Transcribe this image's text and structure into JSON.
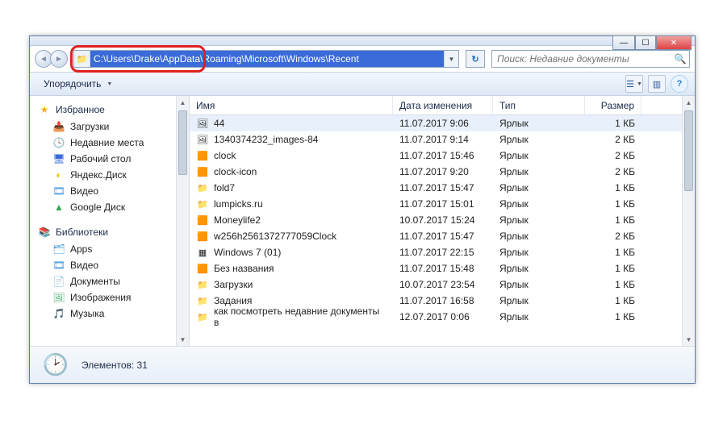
{
  "titlebar": {
    "min": "—",
    "max": "☐",
    "close": "✕"
  },
  "nav": {
    "address": "C:\\Users\\Drake\\AppData\\Roaming\\Microsoft\\Windows\\Recent",
    "search_placeholder": "Поиск: Недавние документы",
    "refresh": "↻",
    "back": "◄",
    "fwd": "►",
    "dd": "▼"
  },
  "toolbar": {
    "organize": "Упорядочить",
    "view": "☰",
    "pane": "▥",
    "help": "?"
  },
  "sidebar": {
    "fav": {
      "label": "Избранное",
      "items": [
        {
          "icon": "folder-dl",
          "label": "Загрузки",
          "color": "#f5b955"
        },
        {
          "icon": "recent",
          "label": "Недавние места",
          "color": "#7a8ea8"
        },
        {
          "icon": "desktop",
          "label": "Рабочий стол",
          "color": "#3a6bd8"
        },
        {
          "icon": "yadisk",
          "label": "Яндекс.Диск",
          "color": "#f0c400"
        },
        {
          "icon": "video",
          "label": "Видео",
          "color": "#3a8fd8"
        },
        {
          "icon": "gdrive",
          "label": "Google Диск",
          "color": "#34a853"
        }
      ]
    },
    "lib": {
      "label": "Библиотеки",
      "items": [
        {
          "icon": "apps",
          "label": "Apps",
          "color": "#4aa0e0"
        },
        {
          "icon": "video",
          "label": "Видео",
          "color": "#3a8fd8"
        },
        {
          "icon": "docs",
          "label": "Документы",
          "color": "#d8a050"
        },
        {
          "icon": "images",
          "label": "Изображения",
          "color": "#50b070"
        },
        {
          "icon": "music",
          "label": "Музыка",
          "color": "#d88030"
        }
      ]
    }
  },
  "columns": {
    "name": "Имя",
    "date": "Дата изменения",
    "type": "Тип",
    "size": "Размер"
  },
  "rows": [
    {
      "icon": "img",
      "name": "44",
      "date": "11.07.2017 9:06",
      "type": "Ярлык",
      "size": "1 КБ",
      "sel": true
    },
    {
      "icon": "img",
      "name": "1340374232_images-84",
      "date": "11.07.2017 9:14",
      "type": "Ярлык",
      "size": "2 КБ"
    },
    {
      "icon": "img2",
      "name": "clock",
      "date": "11.07.2017 15:46",
      "type": "Ярлык",
      "size": "2 КБ"
    },
    {
      "icon": "img2",
      "name": "clock-icon",
      "date": "11.07.2017 9:20",
      "type": "Ярлык",
      "size": "2 КБ"
    },
    {
      "icon": "folder",
      "name": "fold7",
      "date": "11.07.2017 15:47",
      "type": "Ярлык",
      "size": "1 КБ"
    },
    {
      "icon": "folder",
      "name": "lumpicks.ru",
      "date": "11.07.2017 15:01",
      "type": "Ярлык",
      "size": "1 КБ"
    },
    {
      "icon": "img2",
      "name": "Moneylife2",
      "date": "10.07.2017 15:24",
      "type": "Ярлык",
      "size": "1 КБ"
    },
    {
      "icon": "img2",
      "name": "w256h2561372777059Clock",
      "date": "11.07.2017 15:47",
      "type": "Ярлык",
      "size": "2 КБ"
    },
    {
      "icon": "xls",
      "name": "Windows 7 (01)",
      "date": "11.07.2017 22:15",
      "type": "Ярлык",
      "size": "1 КБ"
    },
    {
      "icon": "img2",
      "name": "Без названия",
      "date": "11.07.2017 15:48",
      "type": "Ярлык",
      "size": "1 КБ"
    },
    {
      "icon": "folder",
      "name": "Загрузки",
      "date": "10.07.2017 23:54",
      "type": "Ярлык",
      "size": "1 КБ"
    },
    {
      "icon": "folder",
      "name": "Задания",
      "date": "11.07.2017 16:58",
      "type": "Ярлык",
      "size": "1 КБ"
    },
    {
      "icon": "folder",
      "name": "как посмотреть недавние документы в",
      "date": "12.07.2017 0:06",
      "type": "Ярлык",
      "size": "1 КБ"
    }
  ],
  "status": {
    "count_label": "Элементов: 31"
  },
  "icons": {
    "img": "🖼",
    "img2": "🟧",
    "folder": "📁",
    "xls": "▦",
    "folder-dl": "📥",
    "recent": "🕓",
    "desktop": "🖥",
    "yadisk": "◐",
    "video": "🎞",
    "gdrive": "▲",
    "apps": "🗂",
    "docs": "📄",
    "images": "🖼",
    "music": "🎵",
    "star": "★",
    "libs": "📚",
    "clock": "🕑"
  }
}
